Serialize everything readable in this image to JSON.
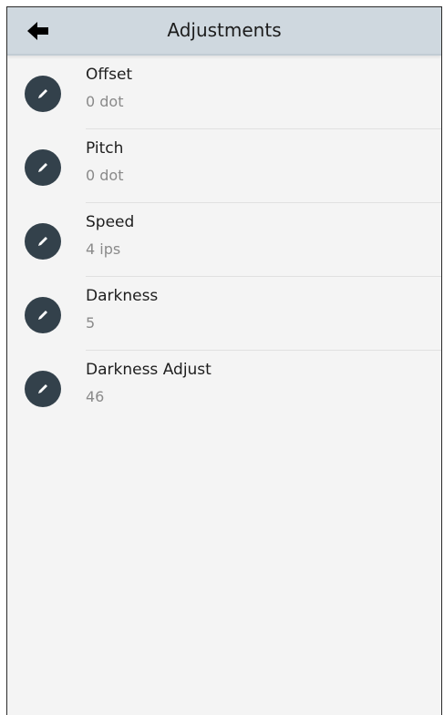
{
  "header": {
    "title": "Adjustments",
    "back_icon": "back-arrow-icon"
  },
  "settings": [
    {
      "label": "Offset",
      "value": "0 dot",
      "icon": "pencil-icon"
    },
    {
      "label": "Pitch",
      "value": "0 dot",
      "icon": "pencil-icon"
    },
    {
      "label": "Speed",
      "value": "4 ips",
      "icon": "pencil-icon"
    },
    {
      "label": "Darkness",
      "value": "5",
      "icon": "pencil-icon"
    },
    {
      "label": "Darkness Adjust",
      "value": "46",
      "icon": "pencil-icon"
    }
  ],
  "colors": {
    "header_bg": "#cfd8df",
    "content_bg": "#f4f4f4",
    "edit_icon_bg": "#33414b",
    "value_text": "#8a8a8a"
  }
}
